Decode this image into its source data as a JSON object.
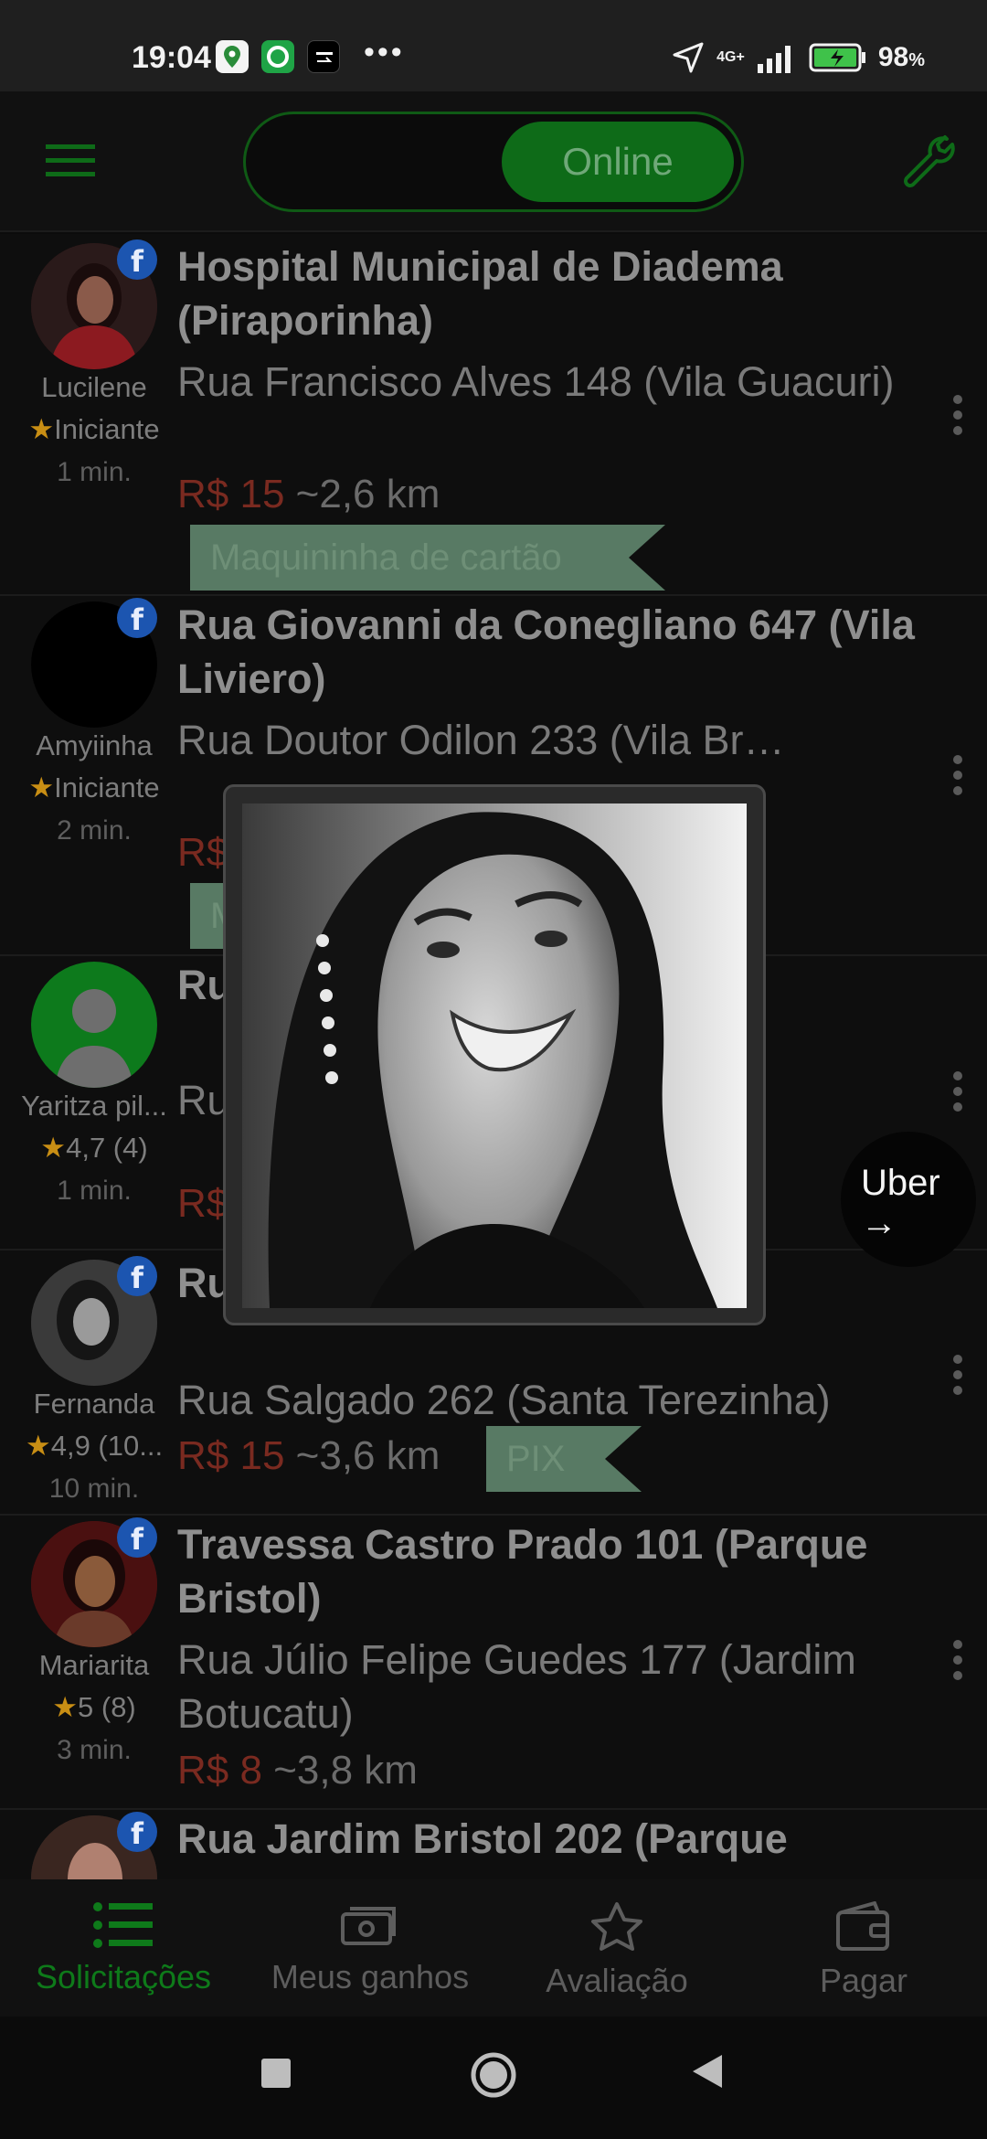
{
  "status_bar": {
    "time": "19:04",
    "network": "4G+",
    "battery": "98",
    "battery_unit": "%",
    "apps": [
      "maps-icon",
      "app-icon",
      "uber-icon"
    ]
  },
  "header": {
    "status_toggle_label": "Online",
    "colors": {
      "accent": "#0e7a1a",
      "price": "#7a2a20"
    }
  },
  "requests": [
    {
      "user": "Lucilene",
      "rating": "Iniciante",
      "time": "1 min.",
      "destination": "Hospital Municipal de Diadema (Piraporinha)",
      "origin": "Rua Francisco Alves 148 (Vila Guacuri)",
      "price": "R$ 15",
      "distance": "~2,6 km",
      "tag": "Maquininha de cartão"
    },
    {
      "user": "Amyiinha",
      "rating": "Iniciante",
      "time": "2 min.",
      "destination": "Rua Giovanni da Conegliano 647 (Vila Liviero)",
      "origin": "Rua Doutor Odilon 233 (Vila Br…",
      "price": "R$",
      "distance": "",
      "tag": "M"
    },
    {
      "user": "Yaritza pil...",
      "rating": "4,7 (4)",
      "time": "1 min.",
      "destination": "Ru… …co 75 (C…",
      "origin": "Ru… …m Sa…",
      "price": "R$",
      "distance": "",
      "tag": ""
    },
    {
      "user": "Fernanda",
      "rating": "4,9 (10...",
      "time": "10 min.",
      "destination": "Ru… …os 123 (Jardim Calux)",
      "origin": "Rua Salgado 262 (Santa Terezinha)",
      "price": "R$ 15",
      "distance": "~3,6 km",
      "tag": "PIX"
    },
    {
      "user": "Mariarita",
      "rating": "5 (8)",
      "time": "3 min.",
      "destination": "Travessa Castro Prado 101 (Parque Bristol)",
      "origin": "Rua Júlio Felipe Guedes 177 (Jardim Botucatu)",
      "price": "R$ 8",
      "distance": "~3,8 km",
      "tag": ""
    },
    {
      "user": "",
      "rating": "",
      "time": "",
      "destination": "Rua Jardim Bristol 202 (Parque",
      "origin": "",
      "price": "",
      "distance": "",
      "tag": ""
    }
  ],
  "uber_bubble": {
    "label": "Uber",
    "arrow": "→"
  },
  "bottom_nav": [
    {
      "label": "Solicitações",
      "icon": "list-icon",
      "active": true
    },
    {
      "label": "Meus ganhos",
      "icon": "money-icon",
      "active": false
    },
    {
      "label": "Avaliação",
      "icon": "star-icon",
      "active": false
    },
    {
      "label": "Pagar",
      "icon": "wallet-icon",
      "active": false
    }
  ]
}
